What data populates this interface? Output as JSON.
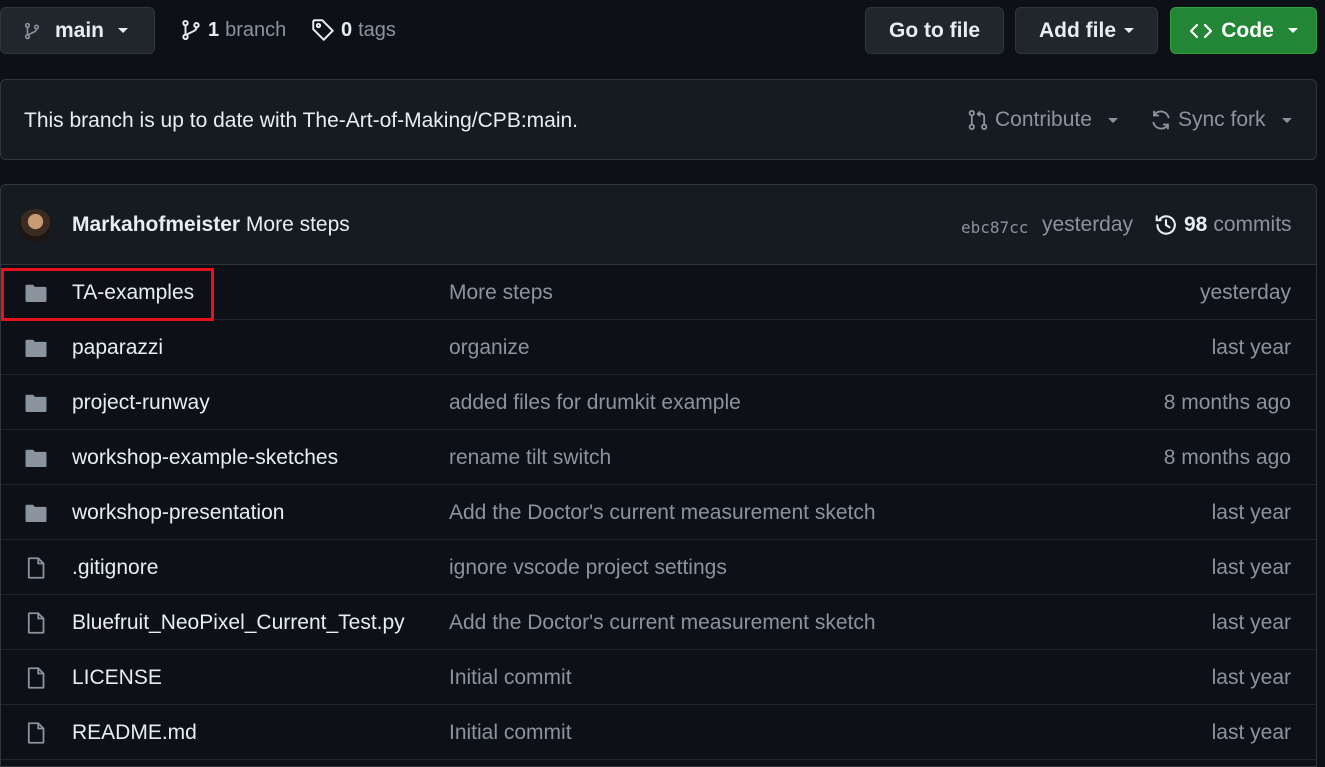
{
  "toolbar": {
    "branch_label": "main",
    "branch_count": "1",
    "branch_word": "branch",
    "tag_count": "0",
    "tag_word": "tags",
    "go_to_file": "Go to file",
    "add_file": "Add file",
    "code": "Code"
  },
  "fork": {
    "status": "This branch is up to date with The-Art-of-Making/CPB:main.",
    "contribute": "Contribute",
    "sync_fork": "Sync fork"
  },
  "latest_commit": {
    "author": "Markahofmeister",
    "message": "More steps",
    "sha": "ebc87cc",
    "time": "yesterday",
    "count": "98",
    "count_word": "commits"
  },
  "files": [
    {
      "type": "folder",
      "name": "TA-examples",
      "message": "More steps",
      "age": "yesterday"
    },
    {
      "type": "folder",
      "name": "paparazzi",
      "message": "organize",
      "age": "last year"
    },
    {
      "type": "folder",
      "name": "project-runway",
      "message": "added files for drumkit example",
      "age": "8 months ago"
    },
    {
      "type": "folder",
      "name": "workshop-example-sketches",
      "message": "rename tilt switch",
      "age": "8 months ago"
    },
    {
      "type": "folder",
      "name": "workshop-presentation",
      "message": "Add the Doctor's current measurement sketch",
      "age": "last year"
    },
    {
      "type": "file",
      "name": ".gitignore",
      "message": "ignore vscode project settings",
      "age": "last year"
    },
    {
      "type": "file",
      "name": "Bluefruit_NeoPixel_Current_Test.py",
      "message": "Add the Doctor's current measurement sketch",
      "age": "last year"
    },
    {
      "type": "file",
      "name": "LICENSE",
      "message": "Initial commit",
      "age": "last year"
    },
    {
      "type": "file",
      "name": "README.md",
      "message": "Initial commit",
      "age": "last year"
    }
  ],
  "colors": {
    "background": "#0d1117",
    "panel": "#161b22",
    "border": "#30363d",
    "code_button": "#238636",
    "highlight": "#e8121c"
  }
}
